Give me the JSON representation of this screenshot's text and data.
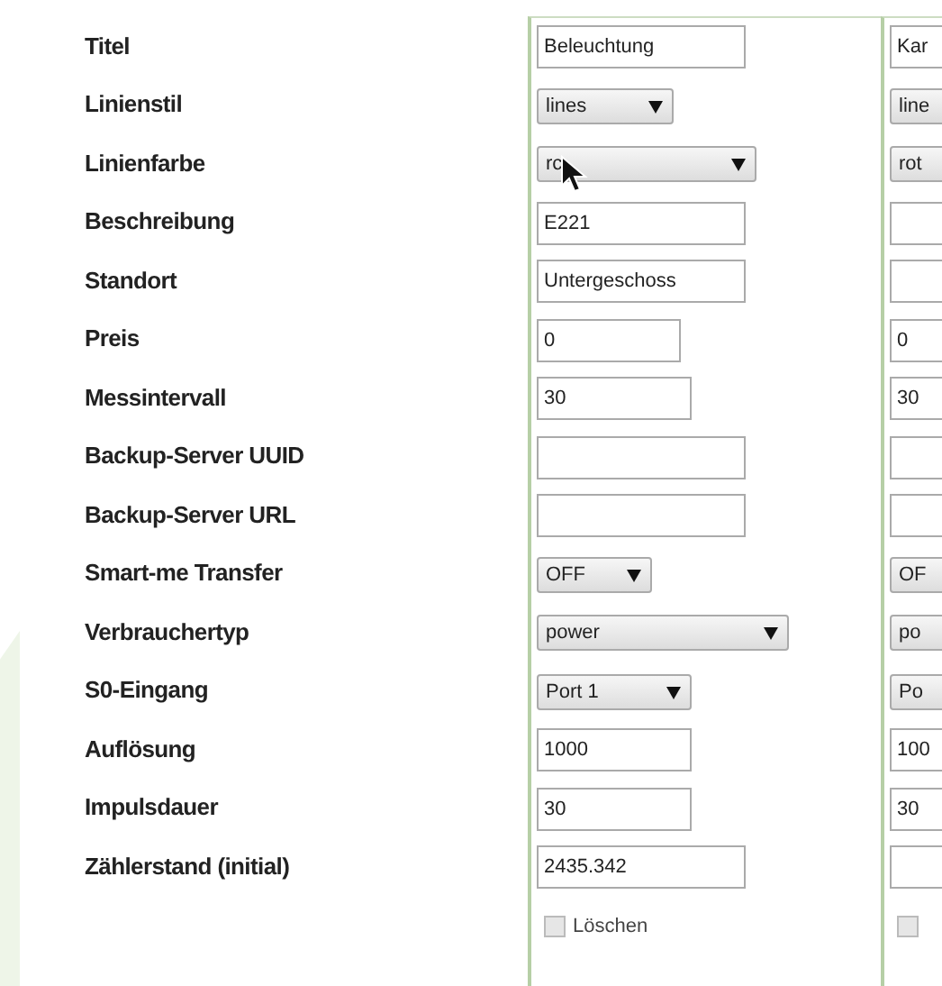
{
  "labels": [
    "Titel",
    "Linienstil",
    "Linienfarbe",
    "Beschreibung",
    "Standort",
    "Preis",
    "Messintervall",
    "Backup-Server UUID",
    "Backup-Server URL",
    "Smart-me Transfer",
    "Verbrauchertyp",
    "S0-Eingang",
    "Auflösung",
    "Impulsdauer",
    "Zählerstand (initial)"
  ],
  "columns": [
    {
      "fields": [
        {
          "kind": "text",
          "value": "Beleuchtung"
        },
        {
          "kind": "select",
          "value": "lines"
        },
        {
          "kind": "select",
          "value": "rc"
        },
        {
          "kind": "text",
          "value": "E221"
        },
        {
          "kind": "text",
          "value": "Untergeschoss"
        },
        {
          "kind": "text",
          "value": "0"
        },
        {
          "kind": "text",
          "value": "30"
        },
        {
          "kind": "text"
        },
        {
          "kind": "text"
        },
        {
          "kind": "select",
          "value": "OFF"
        },
        {
          "kind": "select",
          "value": "power"
        },
        {
          "kind": "select",
          "value": "Port 1"
        },
        {
          "kind": "text",
          "value": "1000"
        },
        {
          "kind": "text",
          "value": "30"
        },
        {
          "kind": "text",
          "value": "2435.342"
        }
      ],
      "delete": {
        "label": "Löschen",
        "checked": false
      }
    },
    {
      "fields": [
        {
          "kind": "text",
          "value": "Kar"
        },
        {
          "kind": "select",
          "value": "line"
        },
        {
          "kind": "select",
          "value": "rot"
        },
        {
          "kind": "text"
        },
        {
          "kind": "text"
        },
        {
          "kind": "text",
          "value": "0"
        },
        {
          "kind": "text",
          "value": "30"
        },
        {
          "kind": "text"
        },
        {
          "kind": "text"
        },
        {
          "kind": "select",
          "value": "OF"
        },
        {
          "kind": "select",
          "value": "po"
        },
        {
          "kind": "select",
          "value": "Po"
        },
        {
          "kind": "text",
          "value": "100"
        },
        {
          "kind": "text",
          "value": "30"
        },
        {
          "kind": "text"
        }
      ],
      "delete": {
        "checked": false
      }
    }
  ]
}
